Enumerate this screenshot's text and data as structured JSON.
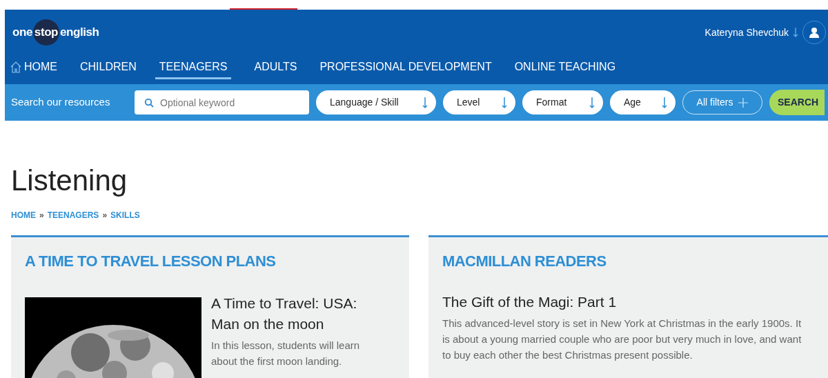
{
  "logo": {
    "words": [
      "one",
      "stop",
      "english"
    ]
  },
  "user": {
    "name": "Kateryna Shevchuk"
  },
  "nav": [
    {
      "label": "HOME",
      "kind": "home",
      "selected": false
    },
    {
      "label": "CHILDREN",
      "kind": "link",
      "selected": false
    },
    {
      "label": "TEENAGERS",
      "kind": "link",
      "selected": true
    },
    {
      "label": "ADULTS",
      "kind": "link",
      "selected": false
    },
    {
      "label": "PROFESSIONAL DEVELOPMENT",
      "kind": "link",
      "selected": false
    },
    {
      "label": "ONLINE TEACHING",
      "kind": "link",
      "selected": false
    }
  ],
  "search_bar": {
    "label": "Search our resources",
    "placeholder": "Optional keyword",
    "filters": [
      "Language / Skill",
      "Level",
      "Format",
      "Age"
    ],
    "all_filters": "All filters",
    "button": "SEARCH"
  },
  "page": {
    "title": "Listening",
    "breadcrumb": [
      {
        "kind": "link",
        "text": "HOME"
      },
      {
        "kind": "separator",
        "text": "»"
      },
      {
        "kind": "link",
        "text": "TEENAGERS"
      },
      {
        "kind": "separator",
        "text": "»"
      },
      {
        "kind": "link",
        "text": "SKILLS"
      }
    ]
  },
  "cards": [
    {
      "heading": "A TIME TO TRAVEL LESSON PLANS",
      "kind": "picture",
      "title": "A Time to Travel: USA: Man on the moon",
      "description": "In this lesson, students will learn about the first moon landing."
    },
    {
      "heading": "MACMILLAN READERS",
      "kind": "text",
      "title": "The Gift of the Magi: Part 1",
      "description": "This advanced-level story is set in New York at Christmas in the early 1900s. It is about a young married couple who are poor but very much in love, and want to buy each other the best Christmas present possible."
    }
  ]
}
